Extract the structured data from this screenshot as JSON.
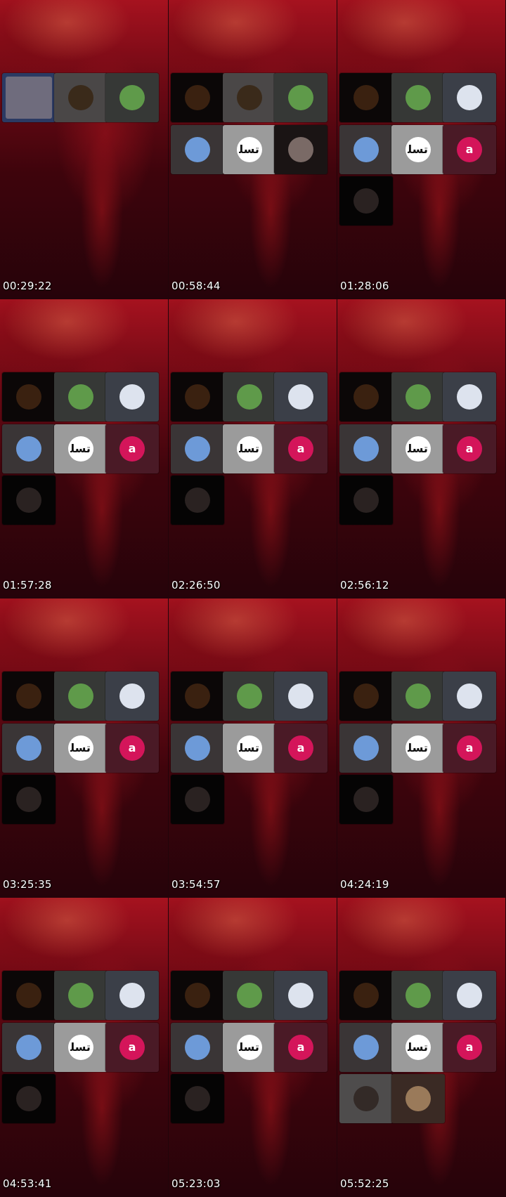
{
  "colors": {
    "wallpaper_top": "#a6121f",
    "wallpaper_bottom": "#26030a",
    "timestamp_text": "#ffffff"
  },
  "apps": {
    "moon": {
      "icon": "moon-app-icon",
      "tile_bg": "#2b3a63",
      "disc_bg": "#6f6c7d",
      "glyph": ""
    },
    "fire": {
      "icon": "campfire-app-icon",
      "tile_bg": "#0b0707",
      "disc_bg": "#3a2110",
      "glyph": ""
    },
    "fire_grey": {
      "icon": "campfire-app-icon",
      "tile_bg": "#4a4747",
      "disc_bg": "#3a2a1a",
      "glyph": ""
    },
    "battery": {
      "icon": "battery-app-icon",
      "tile_bg": "#363836",
      "disc_bg": "#5f9a4a",
      "glyph": ""
    },
    "pen": {
      "icon": "pen-app-icon",
      "tile_bg": "#3b3f48",
      "disc_bg": "#dde3ee",
      "glyph": ""
    },
    "truck": {
      "icon": "truck-app-icon",
      "tile_bg": "#3a3536",
      "disc_bg": "#6d9ad8",
      "glyph": ""
    },
    "calligraphy": {
      "icon": "calligraphy-app-icon",
      "tile_bg": "#9b9b9b",
      "disc_bg": "#ffffff",
      "glyph": "ﺗﺴﻠ"
    },
    "letter_a": {
      "icon": "letter-a-app-icon",
      "tile_bg": "#4a1a26",
      "disc_bg": "#d4155a",
      "glyph": "a"
    },
    "hands": {
      "icon": "hands-app-icon",
      "tile_bg": "#1a1414",
      "disc_bg": "#7a6a66",
      "glyph": ""
    },
    "dark_circle": {
      "icon": "dark-circle-app-icon",
      "tile_bg": "#050404",
      "disc_bg": "#2a2221",
      "glyph": ""
    },
    "dark_circle_grey": {
      "icon": "dark-circle-app-icon",
      "tile_bg": "#4e4c4c",
      "disc_bg": "#332a27",
      "glyph": ""
    },
    "horse": {
      "icon": "horse-app-icon",
      "tile_bg": "#3a2a24",
      "disc_bg": "#9a7a5a",
      "glyph": ""
    }
  },
  "frames": [
    {
      "timestamp": "00:29:22",
      "tiles": [
        "moon",
        "fire_grey",
        "battery"
      ]
    },
    {
      "timestamp": "00:58:44",
      "tiles": [
        "fire",
        "fire_grey",
        "battery",
        "truck",
        "calligraphy",
        "hands"
      ]
    },
    {
      "timestamp": "01:28:06",
      "tiles": [
        "fire",
        "battery",
        "pen",
        "truck",
        "calligraphy",
        "letter_a",
        "dark_circle"
      ]
    },
    {
      "timestamp": "01:57:28",
      "tiles": [
        "fire",
        "battery",
        "pen",
        "truck",
        "calligraphy",
        "letter_a",
        "dark_circle"
      ]
    },
    {
      "timestamp": "02:26:50",
      "tiles": [
        "fire",
        "battery",
        "pen",
        "truck",
        "calligraphy",
        "letter_a",
        "dark_circle"
      ]
    },
    {
      "timestamp": "02:56:12",
      "tiles": [
        "fire",
        "battery",
        "pen",
        "truck",
        "calligraphy",
        "letter_a",
        "dark_circle"
      ]
    },
    {
      "timestamp": "03:25:35",
      "tiles": [
        "fire",
        "battery",
        "pen",
        "truck",
        "calligraphy",
        "letter_a",
        "dark_circle"
      ]
    },
    {
      "timestamp": "03:54:57",
      "tiles": [
        "fire",
        "battery",
        "pen",
        "truck",
        "calligraphy",
        "letter_a",
        "dark_circle"
      ]
    },
    {
      "timestamp": "04:24:19",
      "tiles": [
        "fire",
        "battery",
        "pen",
        "truck",
        "calligraphy",
        "letter_a",
        "dark_circle"
      ]
    },
    {
      "timestamp": "04:53:41",
      "tiles": [
        "fire",
        "battery",
        "pen",
        "truck",
        "calligraphy",
        "letter_a",
        "dark_circle"
      ]
    },
    {
      "timestamp": "05:23:03",
      "tiles": [
        "fire",
        "battery",
        "pen",
        "truck",
        "calligraphy",
        "letter_a",
        "dark_circle"
      ]
    },
    {
      "timestamp": "05:52:25",
      "tiles": [
        "fire",
        "battery",
        "pen",
        "truck",
        "calligraphy",
        "letter_a",
        "dark_circle_grey",
        "horse"
      ]
    }
  ]
}
